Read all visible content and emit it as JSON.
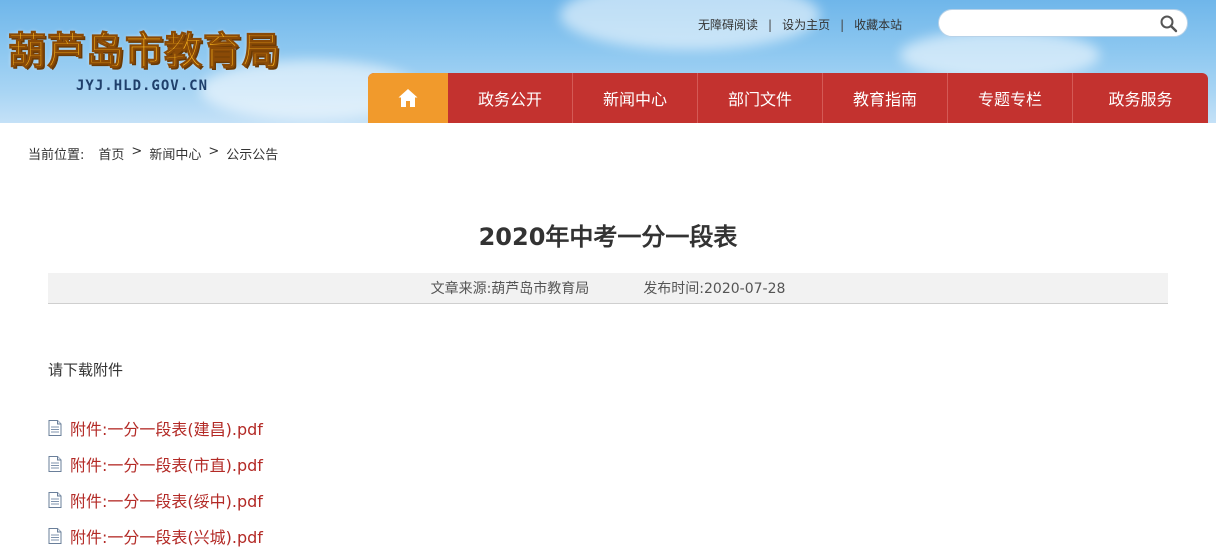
{
  "site": {
    "name": "葫芦岛市教育局",
    "domain": "JYJ.HLD.GOV.CN"
  },
  "toplinks": {
    "accessible": "无障碍阅读",
    "homepage": "设为主页",
    "bookmark": "收藏本站",
    "separator": "|"
  },
  "search": {
    "placeholder": "",
    "value": ""
  },
  "nav": {
    "home_icon": "home-icon",
    "items": [
      {
        "label": "政务公开"
      },
      {
        "label": "新闻中心"
      },
      {
        "label": "部门文件"
      },
      {
        "label": "教育指南"
      },
      {
        "label": "专题专栏"
      },
      {
        "label": "政务服务"
      }
    ]
  },
  "breadcrumb": {
    "lead": "当前位置:",
    "items": [
      "首页",
      "新闻中心",
      "公示公告"
    ],
    "separator": ">"
  },
  "article": {
    "title": "2020年中考一分一段表",
    "source": "文章来源:葫芦岛市教育局",
    "date": "发布时间:2020-07-28",
    "intro": "请下载附件",
    "attachments": [
      "附件:一分一段表(建昌).pdf",
      "附件:一分一段表(市直).pdf",
      "附件:一分一段表(绥中).pdf",
      "附件:一分一段表(兴城).pdf"
    ]
  },
  "colors": {
    "nav_red": "#c3322f",
    "nav_home_orange": "#f19a2c",
    "link_red": "#b32a26",
    "logo_gold": "#f7b21c"
  }
}
